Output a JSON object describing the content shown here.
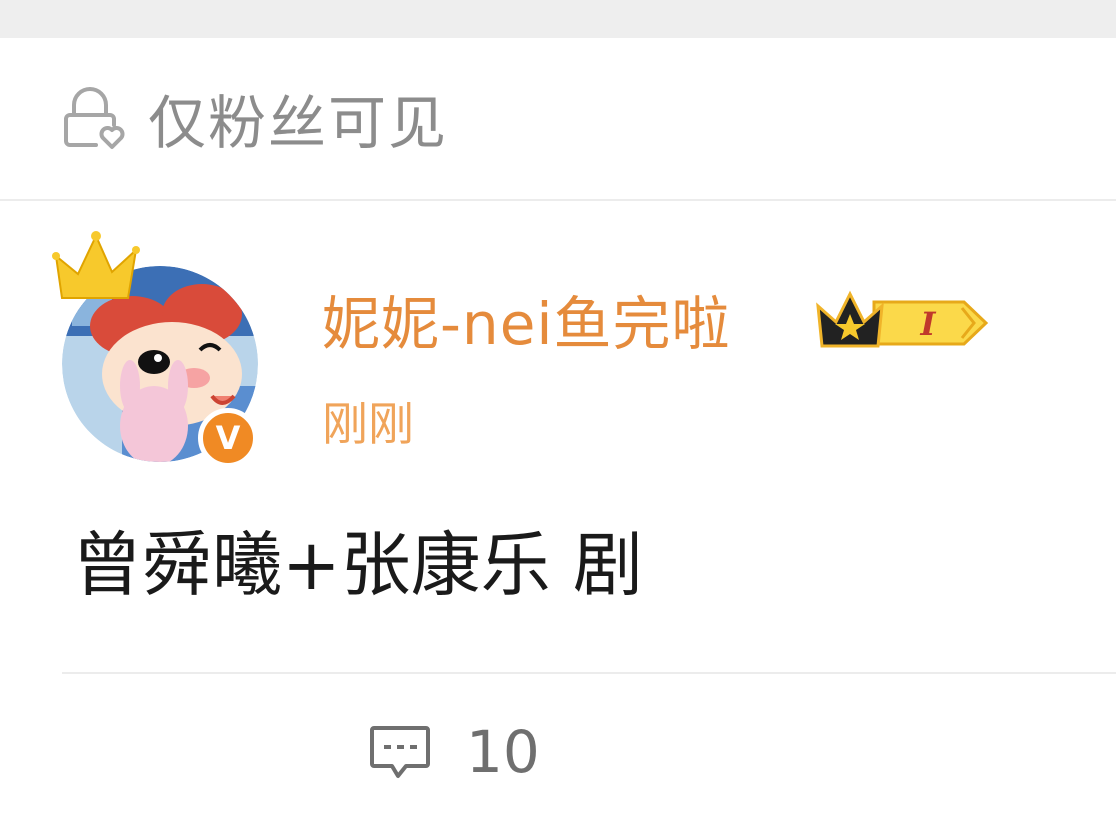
{
  "visibility": {
    "icon": "lock-heart-icon",
    "label": "仅粉丝可见"
  },
  "post": {
    "author": {
      "name": "妮妮-nei鱼完啦",
      "avatar": "cartoon-girl-avatar",
      "verified_badge_letter": "V",
      "level_badge_text": "I",
      "crown_icon": "crown-icon"
    },
    "timestamp": "刚刚",
    "content": "曾舜曦+张康乐 剧"
  },
  "actions": {
    "comment": {
      "icon": "comment-icon",
      "count": "10"
    }
  },
  "colors": {
    "username": "#e58b3c",
    "timestamp": "#f0a45a",
    "verified": "#f08a24",
    "muted_text": "#8c8c8c"
  }
}
